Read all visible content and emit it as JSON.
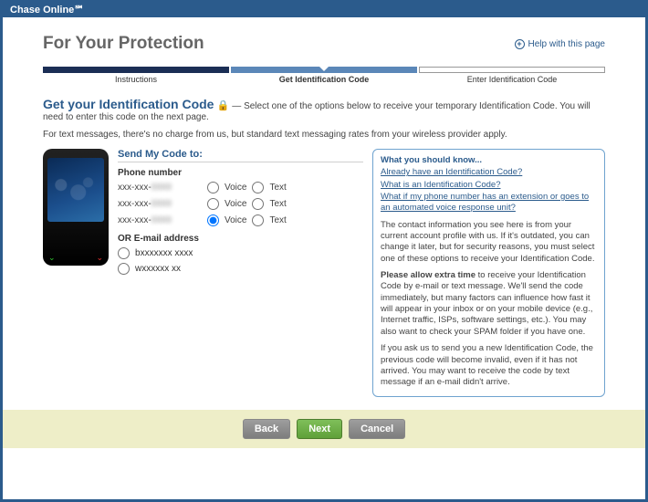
{
  "window": {
    "title": "Chase Online℠"
  },
  "header": {
    "title": "For Your Protection",
    "help_link": "Help with this page"
  },
  "stepper": {
    "steps": [
      {
        "label": "Instructions"
      },
      {
        "label": "Get Identification Code"
      },
      {
        "label": "Enter Identification Code"
      }
    ]
  },
  "subhead": {
    "title": "Get your Identification Code",
    "dash": " — ",
    "text": "Select one of the options below to receive your temporary Identification Code. You will need to enter this code on the next page."
  },
  "note": "For text messages, there's no charge from us, but standard text messaging rates from your wireless provider apply.",
  "form": {
    "section_head": "Send My Code to:",
    "phone_label": "Phone number",
    "email_label": "OR E-mail address",
    "voice": "Voice",
    "text": "Text",
    "phones": [
      {
        "prefix": "xxx-xxx-",
        "masked": "0000"
      },
      {
        "prefix": "xxx-xxx-",
        "masked": "0000"
      },
      {
        "prefix": "xxx-xxx-",
        "masked": "0000"
      }
    ],
    "emails": [
      {
        "prefix": "b",
        "masked": "xxxxxxx xxxx"
      },
      {
        "prefix": "w",
        "masked": "xxxxxx xx"
      }
    ]
  },
  "info": {
    "title": "What you should know...",
    "links": [
      "Already have an Identification Code?",
      "What is an Identification Code?",
      "What if my phone number has an extension or goes to an automated voice response unit?"
    ],
    "p1": "The contact information you see here is from your current account profile with us. If it's outdated, you can change it later, but for security reasons, you must select one of these options to receive your Identification Code.",
    "p2a": "Please allow extra time",
    "p2b": " to receive your Identification Code by e-mail or text message. We'll send the code immediately, but many factors can influence how fast it will appear in your inbox or on your mobile device (e.g., Internet traffic, ISPs, software settings, etc.). You may also want to check your SPAM folder if you have one.",
    "p3": "If you ask us to send you a new Identification Code, the previous code will become invalid, even if it has not arrived. You may want to receive the code by text message if an e-mail didn't arrive."
  },
  "buttons": {
    "back": "Back",
    "next": "Next",
    "cancel": "Cancel"
  }
}
